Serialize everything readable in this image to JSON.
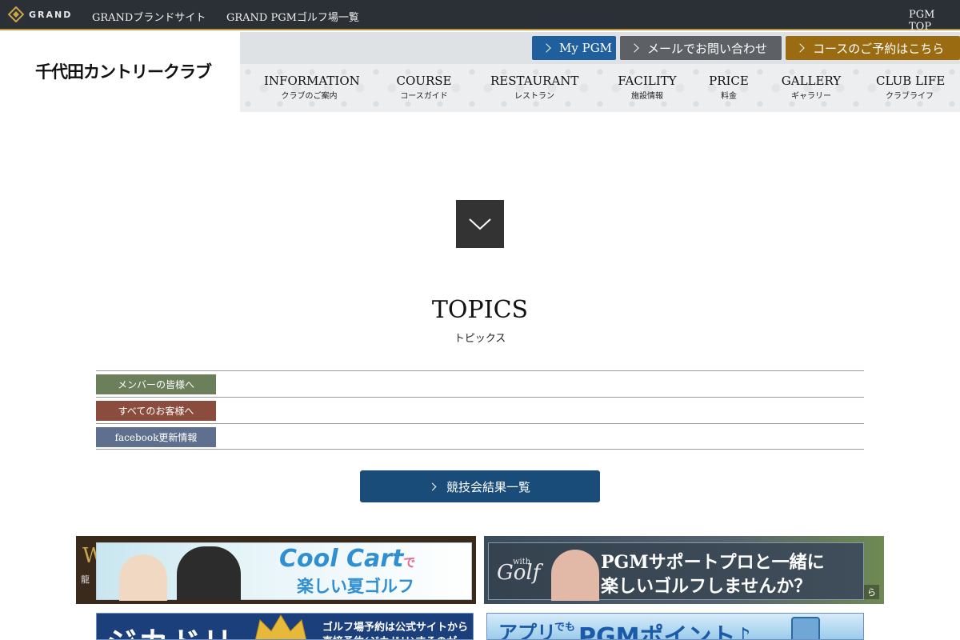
{
  "topbar": {
    "logo_text": "GRAND",
    "links": [
      "GRANDブランドサイト",
      "GRAND PGMゴルフ場一覧"
    ],
    "pgm_top": "PGM TOP"
  },
  "header": {
    "club_name": "千代田カントリークラブ",
    "buttons": {
      "mypgm": "My PGM",
      "mail": "メールでお問い合わせ",
      "reserve": "コースのご予約はこちら"
    },
    "nav": [
      {
        "en": "INFORMATION",
        "ja": "クラブのご案内"
      },
      {
        "en": "COURSE",
        "ja": "コースガイド"
      },
      {
        "en": "RESTAURANT",
        "ja": "レストラン"
      },
      {
        "en": "FACILITY",
        "ja": "施設情報"
      },
      {
        "en": "PRICE",
        "ja": "料金"
      },
      {
        "en": "GALLERY",
        "ja": "ギャラリー"
      },
      {
        "en": "CLUB LIFE",
        "ja": "クラブライフ"
      }
    ]
  },
  "topics": {
    "title": "TOPICS",
    "subtitle": "トピックス",
    "rows": [
      {
        "label": "メンバーの皆様へ",
        "color": "#6b7f5a"
      },
      {
        "label": "すべてのお客様へ",
        "color": "#8a4c3c"
      },
      {
        "label": "facebook更新情報",
        "color": "#5f6f8e"
      }
    ],
    "results_button": "競技会結果一覧"
  },
  "banners": {
    "cool_cart": {
      "title": "Cool Cart",
      "de": "で",
      "sub": "楽しい夏ゴルフ",
      "side_w": "W",
      "side_s": "龍"
    },
    "with_golf": {
      "logo": "Golf",
      "logo_small": "with",
      "line1": "PGMサポートプロと一緒に",
      "line2": "楽しいゴルフしませんか？",
      "more": "ら"
    },
    "jikadori": {
      "big": "ジカドリ",
      "line1": "ゴルフ場予約は公式サイトから",
      "line2": "直接予約(ジカドリ)するのが"
    },
    "app": {
      "a1": "アプリ",
      "a2": "でも",
      "a3": "PGMポイント♪"
    }
  },
  "colors": {
    "topbar_bg": "#2b3036",
    "accent_gold": "#b8963e",
    "mypgm_blue": "#1f5f9e",
    "mail_gray": "#5d6166",
    "reserve_gold": "#9b6b12",
    "results_blue": "#1a4c7a"
  }
}
